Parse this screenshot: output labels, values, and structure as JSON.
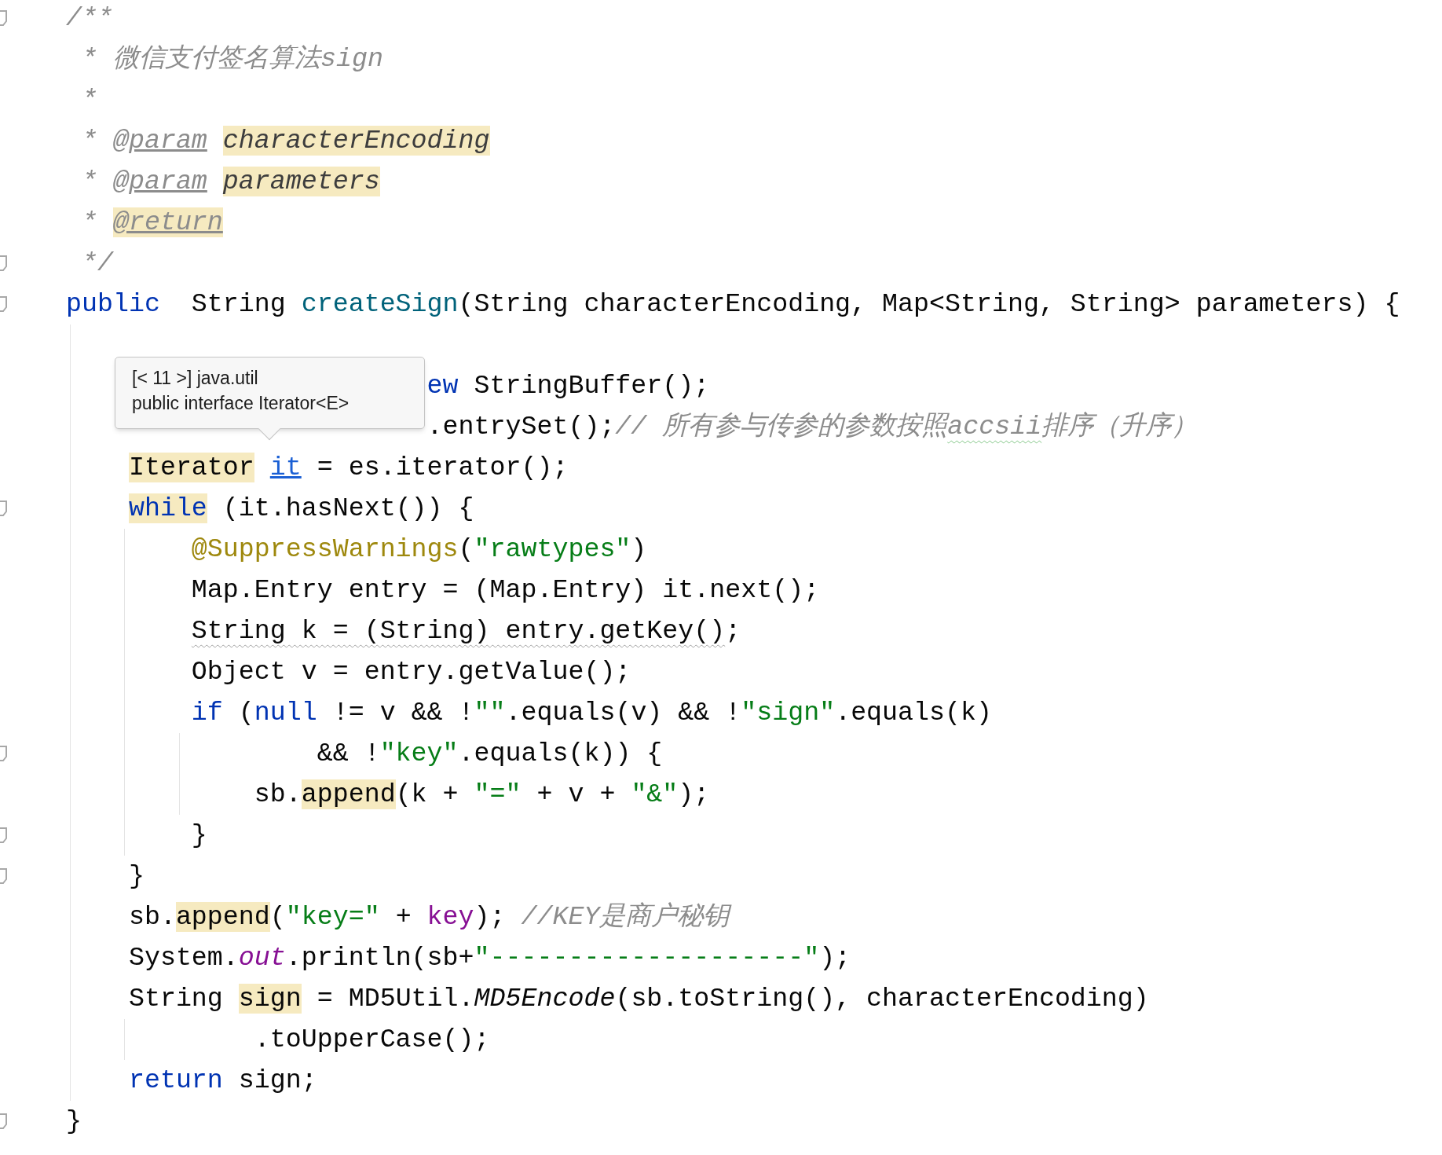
{
  "editor": {
    "lines": [
      {
        "fold": true,
        "tokens": [
          {
            "t": "/**",
            "kind": "doc",
            "highlighted": false
          }
        ]
      },
      {
        "fold": false,
        "tokens": [
          {
            "t": " * 微信支付签名算法sign",
            "kind": "doc",
            "highlighted": false
          }
        ]
      },
      {
        "fold": false,
        "tokens": [
          {
            "t": " *",
            "kind": "doc",
            "highlighted": false
          }
        ]
      },
      {
        "fold": false,
        "tokens": [
          {
            "t": " *",
            "kind": "doc",
            "highlighted": false
          },
          {
            "t": " @param",
            "kind": "doctag",
            "highlighted": false
          },
          {
            "t": " characterEncoding",
            "kind": "docparam",
            "highlighted": true
          }
        ]
      },
      {
        "fold": false,
        "tokens": [
          {
            "t": " *",
            "kind": "doc",
            "highlighted": false
          },
          {
            "t": " @param",
            "kind": "doctag",
            "highlighted": false
          },
          {
            "t": " parameters",
            "kind": "docparam",
            "highlighted": true
          }
        ]
      },
      {
        "fold": false,
        "tokens": [
          {
            "t": " *",
            "kind": "doc",
            "highlighted": false
          },
          {
            "t": " @return",
            "kind": "doctag",
            "highlighted": true
          }
        ]
      },
      {
        "fold": true,
        "tokens": [
          {
            "t": " */",
            "kind": "doc",
            "highlighted": false
          }
        ]
      },
      {
        "fold": true,
        "tokens": [
          {
            "t": "public",
            "kind": "kw",
            "highlighted": false
          },
          {
            "t": "  String ",
            "kind": "plain",
            "highlighted": false
          },
          {
            "t": "createSign",
            "kind": "fn",
            "highlighted": false
          },
          {
            "t": "(String characterEncoding, Map<String, String> parameters) {",
            "kind": "plain",
            "highlighted": false
          }
        ]
      },
      {
        "fold": false
      },
      {
        "fold": false,
        "tokens": [
          {
            "t": "                       ew",
            "kind": "kw",
            "highlighted": false
          },
          {
            "t": " StringBuffer();",
            "kind": "plain",
            "highlighted": false
          }
        ]
      },
      {
        "fold": false,
        "tokens": [
          {
            "t": "                       .entrySet();",
            "kind": "plain",
            "highlighted": false
          },
          {
            "t": "// 所有参与传参的参数按照",
            "kind": "comment",
            "highlighted": false
          },
          {
            "t": "accsii",
            "kind": "typo",
            "highlighted": false
          },
          {
            "t": "排序（升序）",
            "kind": "comment",
            "highlighted": false
          }
        ]
      },
      {
        "fold": false,
        "tokens": [
          {
            "t": "    Iterator",
            "kind": "plain",
            "highlighted": true
          },
          {
            "t": " it",
            "kind": "link",
            "highlighted": false
          },
          {
            "t": " = es.iterator();",
            "kind": "plain",
            "highlighted": false
          }
        ]
      },
      {
        "fold": true,
        "tokens": [
          {
            "t": "    while",
            "kind": "kw",
            "highlighted": true
          },
          {
            "t": " (it.hasNext()) {",
            "kind": "plain",
            "highlighted": false
          }
        ]
      },
      {
        "fold": false,
        "tokens": [
          {
            "t": "        @SuppressWarnings",
            "kind": "ann",
            "highlighted": false
          },
          {
            "t": "(",
            "kind": "plain",
            "highlighted": false
          },
          {
            "t": "\"rawtypes\"",
            "kind": "str",
            "highlighted": false
          },
          {
            "t": ")",
            "kind": "plain",
            "highlighted": false
          }
        ]
      },
      {
        "fold": false,
        "tokens": [
          {
            "t": "        Map.Entry entry = (Map.Entry) it.next();",
            "kind": "plain",
            "highlighted": false
          }
        ]
      },
      {
        "fold": false,
        "tokens": [
          {
            "t": "        String k = (String) entry.getKey()",
            "kind": "warning",
            "highlighted": false
          },
          {
            "t": ";",
            "kind": "plain",
            "highlighted": false
          }
        ]
      },
      {
        "fold": false,
        "tokens": [
          {
            "t": "        Object v = entry.getValue();",
            "kind": "plain",
            "highlighted": false
          }
        ]
      },
      {
        "fold": false,
        "tokens": [
          {
            "t": "        if",
            "kind": "kw",
            "highlighted": false
          },
          {
            "t": " (",
            "kind": "plain",
            "highlighted": false
          },
          {
            "t": "null",
            "kind": "kw",
            "highlighted": false
          },
          {
            "t": " != v && !",
            "kind": "plain",
            "highlighted": false
          },
          {
            "t": "\"\"",
            "kind": "str",
            "highlighted": false
          },
          {
            "t": ".equals(v) && !",
            "kind": "plain",
            "highlighted": false
          },
          {
            "t": "\"sign\"",
            "kind": "str",
            "highlighted": false
          },
          {
            "t": ".equals(k)",
            "kind": "plain",
            "highlighted": false
          }
        ]
      },
      {
        "fold": true,
        "tokens": [
          {
            "t": "                && !",
            "kind": "plain",
            "highlighted": false
          },
          {
            "t": "\"key\"",
            "kind": "str",
            "highlighted": false
          },
          {
            "t": ".equals(k)) {",
            "kind": "plain",
            "highlighted": false
          }
        ]
      },
      {
        "fold": false,
        "tokens": [
          {
            "t": "            sb.",
            "kind": "plain",
            "highlighted": false
          },
          {
            "t": "append",
            "kind": "plain",
            "highlighted": true
          },
          {
            "t": "(k + ",
            "kind": "plain",
            "highlighted": false
          },
          {
            "t": "\"=\"",
            "kind": "str",
            "highlighted": false
          },
          {
            "t": " + v + ",
            "kind": "plain",
            "highlighted": false
          },
          {
            "t": "\"&\"",
            "kind": "str",
            "highlighted": false
          },
          {
            "t": ");",
            "kind": "plain",
            "highlighted": false
          }
        ]
      },
      {
        "fold": true,
        "tokens": [
          {
            "t": "        }",
            "kind": "plain",
            "highlighted": false
          }
        ]
      },
      {
        "fold": true,
        "tokens": [
          {
            "t": "    }",
            "kind": "plain",
            "highlighted": false
          }
        ]
      },
      {
        "fold": false,
        "tokens": [
          {
            "t": "    sb.",
            "kind": "plain",
            "highlighted": false
          },
          {
            "t": "append",
            "kind": "plain",
            "highlighted": true
          },
          {
            "t": "(",
            "kind": "plain",
            "highlighted": false
          },
          {
            "t": "\"key=\"",
            "kind": "str",
            "highlighted": false
          },
          {
            "t": " + ",
            "kind": "plain",
            "highlighted": false
          },
          {
            "t": "key",
            "kind": "field",
            "highlighted": false
          },
          {
            "t": "); ",
            "kind": "plain",
            "highlighted": false
          },
          {
            "t": "//KEY是商户秘钥",
            "kind": "comment",
            "highlighted": false
          }
        ]
      },
      {
        "fold": false,
        "tokens": [
          {
            "t": "    System.",
            "kind": "plain",
            "highlighted": false
          },
          {
            "t": "out",
            "kind": "sfield",
            "highlighted": false
          },
          {
            "t": ".println(sb+",
            "kind": "plain",
            "highlighted": false
          },
          {
            "t": "\"--------------------\"",
            "kind": "str",
            "highlighted": false
          },
          {
            "t": ");",
            "kind": "plain",
            "highlighted": false
          }
        ]
      },
      {
        "fold": false,
        "tokens": [
          {
            "t": "    String ",
            "kind": "plain",
            "highlighted": false
          },
          {
            "t": "sign",
            "kind": "plain",
            "highlighted": true
          },
          {
            "t": " = MD5Util.",
            "kind": "plain",
            "highlighted": false
          },
          {
            "t": "MD5Encode",
            "kind": "static",
            "highlighted": false
          },
          {
            "t": "(sb.toString(), characterEncoding)",
            "kind": "plain",
            "highlighted": false
          }
        ]
      },
      {
        "fold": false,
        "tokens": [
          {
            "t": "            .toUpperCase();",
            "kind": "plain",
            "highlighted": false
          }
        ]
      },
      {
        "fold": false,
        "tokens": [
          {
            "t": "    return",
            "kind": "kw",
            "highlighted": false
          },
          {
            "t": " sign;",
            "kind": "plain",
            "highlighted": false
          }
        ]
      },
      {
        "fold": true,
        "tokens": [
          {
            "t": "}",
            "kind": "plain",
            "highlighted": false
          }
        ]
      }
    ]
  },
  "tooltip": {
    "lines": [
      "[< 11 >] java.util",
      "public interface Iterator<E>"
    ]
  }
}
